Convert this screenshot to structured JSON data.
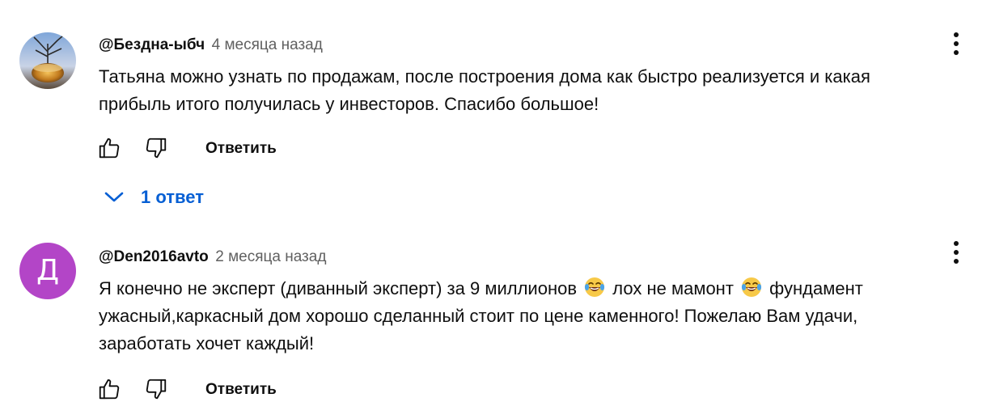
{
  "comments": [
    {
      "author": "@Бездна-ыбч",
      "time": "4 месяца назад",
      "text": "Татьяна можно узнать по продажам, после построения  дома как быстро реализуется и какая\nприбыль итого получилась у инвесторов. Спасибо большое!",
      "reply_label": "Ответить",
      "replies_label": "1 ответ"
    },
    {
      "author": "@Den2016avto",
      "time": "2 месяца назад",
      "avatar_letter": "Д",
      "text_parts": [
        "Я конечно не эксперт (диванный эксперт) за 9 миллионов",
        "лох не мамонт",
        "фундамент\nужасный,каркасный дом хорошо сделанный стоит по цене каменного! Пожелаю Вам удачи,\nзаработать хочет каждый!"
      ],
      "reply_label": "Ответить"
    }
  ],
  "colors": {
    "link_blue": "#065fd4",
    "avatar_purple": "#b345c7",
    "secondary_text": "#606060"
  },
  "icons": [
    "like-icon",
    "dislike-icon",
    "more-vert-icon",
    "chevron-down-icon",
    "laughing-emoji"
  ]
}
